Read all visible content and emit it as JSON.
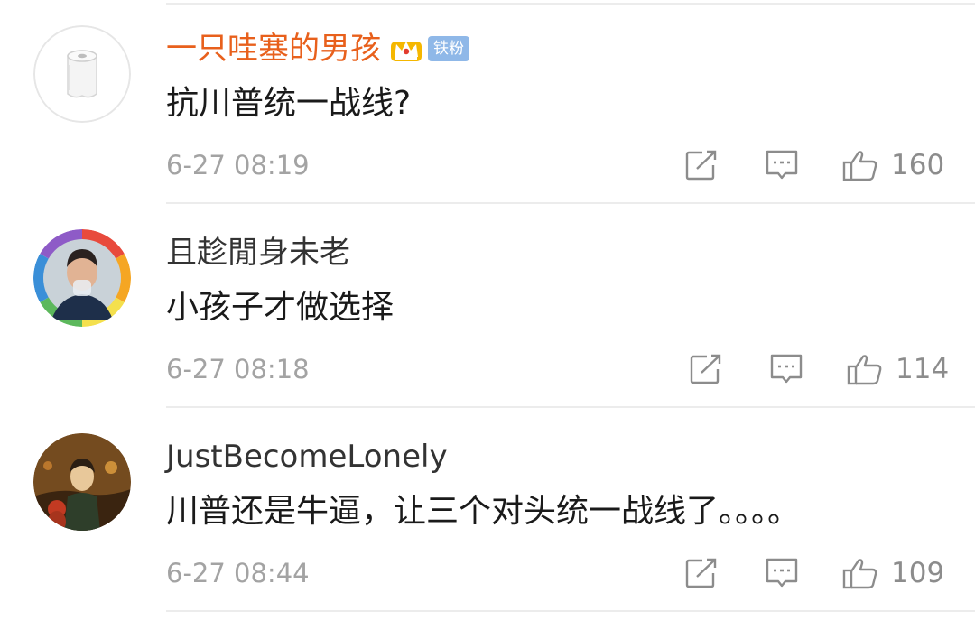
{
  "comments": [
    {
      "username": "一只哇塞的男孩",
      "badge": "铁粉",
      "text": "抗川普统一战线?",
      "time": "6-27 08:19",
      "likes": "160",
      "avatar_icon": "toilet-paper-avatar"
    },
    {
      "username": "且趁閒身未老",
      "text": "小孩子才做选择",
      "time": "6-27 08:18",
      "likes": "114",
      "avatar_icon": "rainbow-ring-portrait-avatar"
    },
    {
      "username": "JustBecomeLonely",
      "text": "川普还是牛逼，让三个对头统一战线了。。。。",
      "time": "6-27 08:44",
      "likes": "109",
      "avatar_icon": "anime-illustration-avatar"
    }
  ],
  "colors": {
    "vip_name": "#e8601c",
    "name": "#333333",
    "body_text": "#1a1a1a",
    "meta": "#a3a3a3",
    "badge_bg": "#8fb8e8",
    "divider": "#ececec"
  },
  "icons": {
    "share": "share-icon",
    "reply": "reply-icon",
    "like": "thumbs-up-icon",
    "vip": "crown-icon"
  }
}
